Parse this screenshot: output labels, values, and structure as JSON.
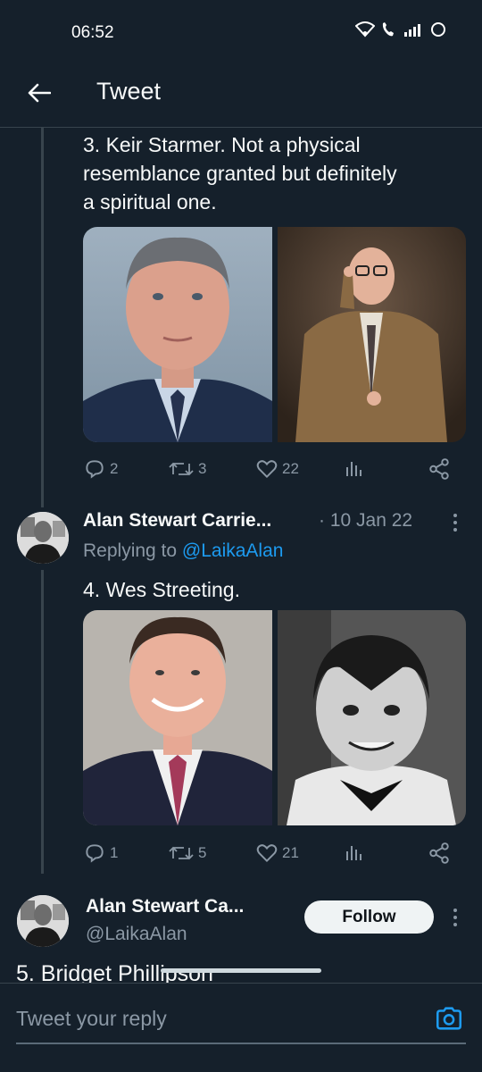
{
  "status_bar": {
    "time": "06:52"
  },
  "header": {
    "title": "Tweet"
  },
  "tweet1": {
    "text_lines": [
      "3. Keir Starmer. Not a physical",
      "resemblance granted but definitely",
      "a spiritual one."
    ],
    "stats": {
      "replies": "2",
      "retweets": "3",
      "likes": "22"
    }
  },
  "tweet2": {
    "author_name": "Alan Stewart Carrie...",
    "date": "· 10 Jan 22",
    "replying_prefix": "Replying to ",
    "replying_handle": "@LaikaAlan",
    "text": "4. Wes Streeting.",
    "stats": {
      "replies": "1",
      "retweets": "5",
      "likes": "21"
    }
  },
  "tweet3": {
    "author_name": "Alan Stewart Ca...",
    "handle": "@LaikaAlan",
    "follow_label": "Follow",
    "partial_text": "5. Bridget Phillipson"
  },
  "reply_bar": {
    "placeholder": "Tweet your reply"
  },
  "colors": {
    "background": "#15202b",
    "accent": "#1d9bf0",
    "muted": "#8b98a5",
    "divider": "#38444d"
  },
  "icons": [
    "back-arrow-icon",
    "wifi-icon",
    "call-icon",
    "signal-icon",
    "battery-icon",
    "reply-icon",
    "retweet-icon",
    "like-icon",
    "analytics-icon",
    "share-icon",
    "more-icon",
    "camera-icon"
  ]
}
